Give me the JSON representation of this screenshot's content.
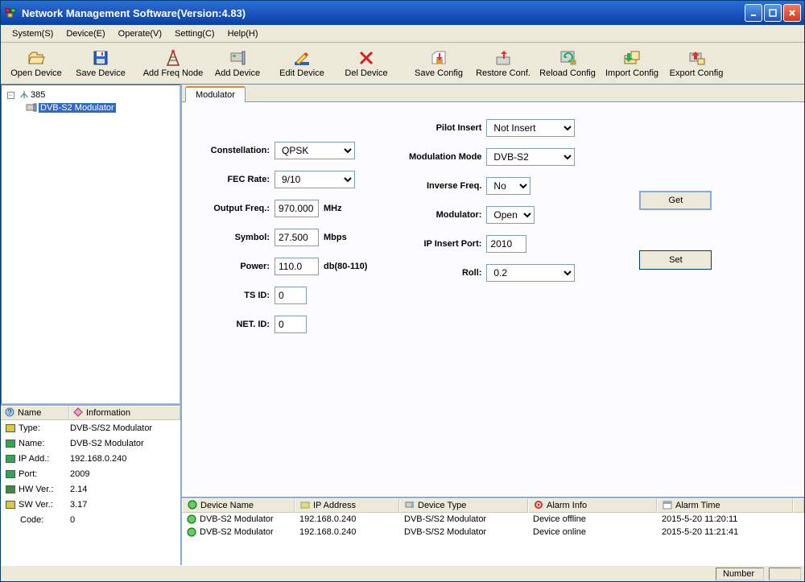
{
  "title": "Network Management Software(Version:4.83)",
  "menu": {
    "system": "System(S)",
    "device": "Device(E)",
    "operate": "Operate(V)",
    "setting": "Setting(C)",
    "help": "Help(H)"
  },
  "toolbar": {
    "open_device": "Open Device",
    "save_device": "Save Device",
    "add_freq_node": "Add Freq Node",
    "add_device": "Add Device",
    "edit_device": "Edit Device",
    "del_device": "Del Device",
    "save_config": "Save Config",
    "restore_conf": "Restore Conf.",
    "reload_config": "Reload Config",
    "import_config": "Import Config",
    "export_config": "Export Config"
  },
  "tree": {
    "root": "385",
    "item1": "DVB-S2 Modulator"
  },
  "info_header": {
    "name": "Name",
    "information": "Information"
  },
  "info": [
    {
      "label": "Type:",
      "value": "DVB-S/S2 Modulator",
      "iconColor": "#d8cc3a"
    },
    {
      "label": "Name:",
      "value": "DVB-S2 Modulator",
      "iconColor": "#2fa84f"
    },
    {
      "label": "IP Add.:",
      "value": "192.168.0.240",
      "iconColor": "#2fa84f"
    },
    {
      "label": "Port:",
      "value": "2009",
      "iconColor": "#2fa84f"
    },
    {
      "label": "HW Ver.:",
      "value": "2.14",
      "iconColor": "#3e8b3e"
    },
    {
      "label": "SW Ver.:",
      "value": "3.17",
      "iconColor": "#d8cc3a"
    },
    {
      "label": "Code:",
      "value": "0",
      "iconColor": ""
    }
  ],
  "tab": {
    "modulator": "Modulator"
  },
  "form": {
    "constellation_label": "Constellation:",
    "constellation": "QPSK",
    "fec_label": "FEC Rate:",
    "fec": "9/10",
    "outfreq_label": "Output Freq.:",
    "outfreq": "970.000",
    "outfreq_unit": "MHz",
    "symbol_label": "Symbol:",
    "symbol": "27.500",
    "symbol_unit": "Mbps",
    "power_label": "Power:",
    "power": "110.0",
    "power_unit": "db(80-110)",
    "tsid_label": "TS ID:",
    "tsid": "0",
    "netid_label": "NET. ID:",
    "netid": "0",
    "pilot_label": "Pilot Insert",
    "pilot": "Not Insert",
    "modmode_label": "Modulation Mode",
    "modmode": "DVB-S2",
    "invfreq_label": "Inverse Freq.",
    "invfreq": "No",
    "modulator_label": "Modulator:",
    "modulator": "Open",
    "ipport_label": "IP Insert Port:",
    "ipport": "2010",
    "roll_label": "Roll:",
    "roll": "0.2"
  },
  "buttons": {
    "get": "Get",
    "set": "Set"
  },
  "dev_header": {
    "name": "Device Name",
    "ip": "IP Address",
    "type": "Device Type",
    "alarm": "Alarm Info",
    "time": "Alarm Time"
  },
  "dev_rows": [
    {
      "name": "DVB-S2 Modulator",
      "ip": "192.168.0.240",
      "type": "DVB-S/S2 Modulator",
      "alarm": "Device offline",
      "time": "2015-5-20 11:20:11"
    },
    {
      "name": "DVB-S2 Modulator",
      "ip": "192.168.0.240",
      "type": "DVB-S/S2 Modulator",
      "alarm": "Device online",
      "time": "2015-5-20 11:21:41"
    }
  ],
  "status": {
    "number": "Number"
  }
}
